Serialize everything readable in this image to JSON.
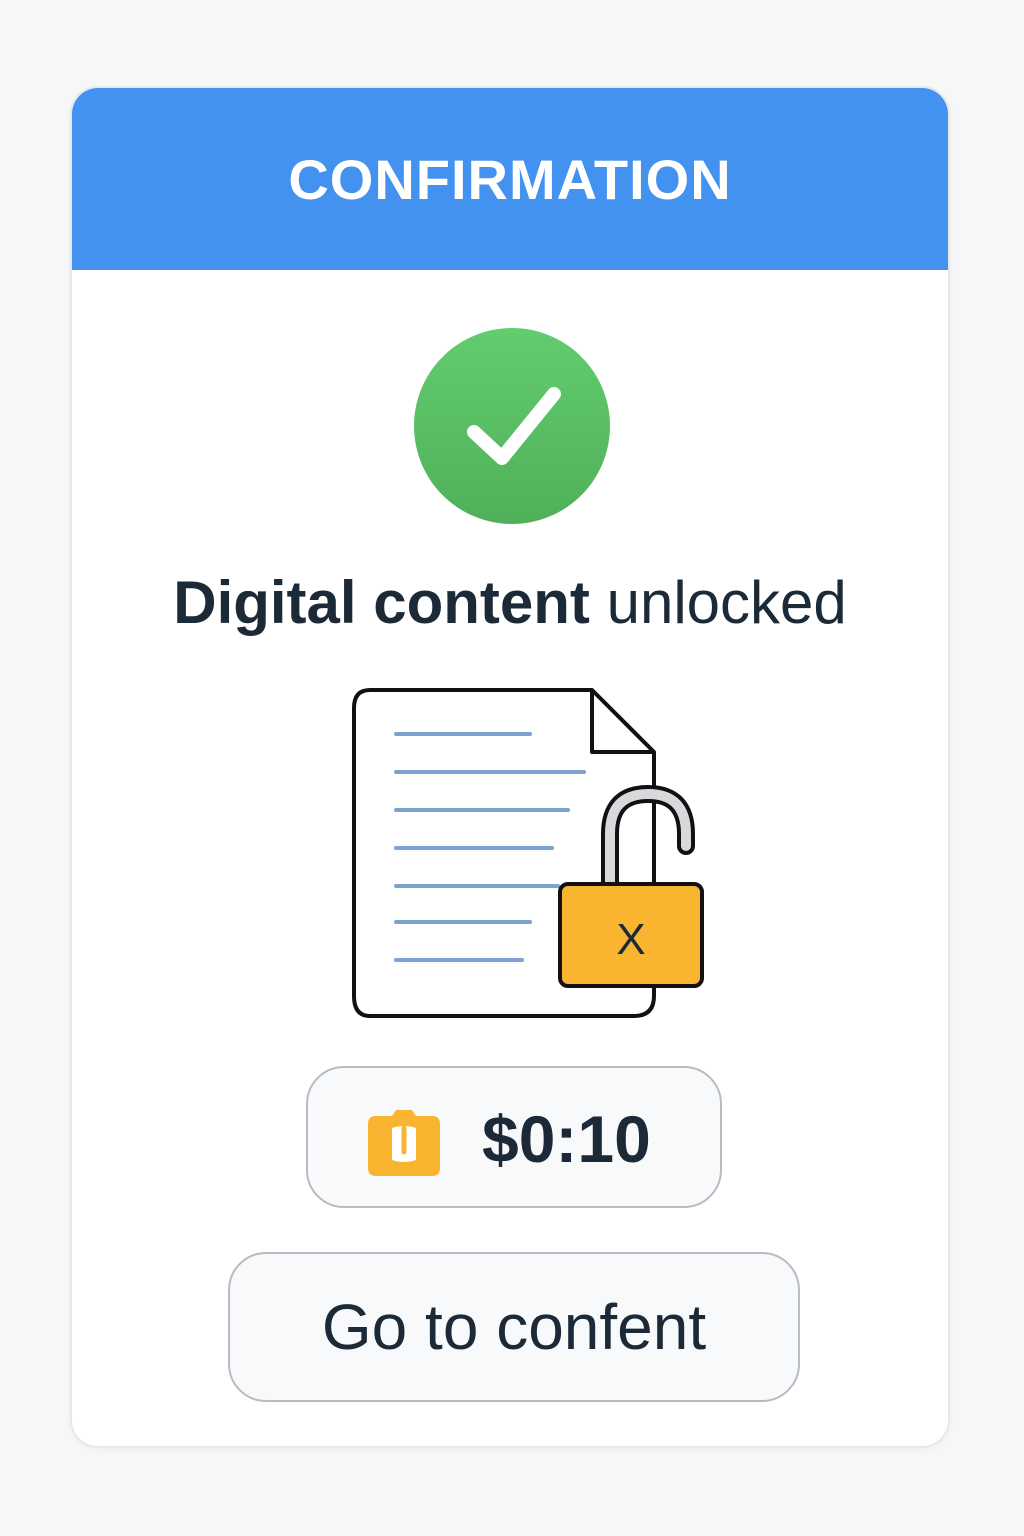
{
  "dialog": {
    "title": "CONFIRMATION",
    "headline_bold": "Digital content",
    "headline_rest": " unlocked",
    "illustration": {
      "document_icon": "document-icon",
      "padlock_icon": "open-padlock-icon",
      "padlock_mark": "X"
    },
    "price": {
      "icon": "wallet-icon",
      "value": "$0:10"
    },
    "action": {
      "label": "Go to confent"
    }
  },
  "colors": {
    "header": "#4492ef",
    "success": "#5bbf66",
    "padlock": "#f9b52f",
    "text": "#1c2a38",
    "document_lines": "#7da2cf"
  }
}
